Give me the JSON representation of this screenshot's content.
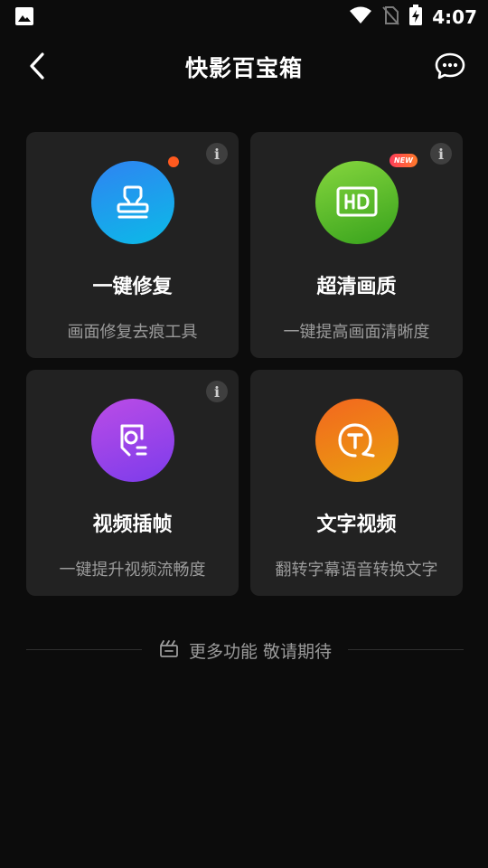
{
  "status_bar": {
    "time": "4:07",
    "icons": [
      "image-icon",
      "wifi-icon",
      "no-sim-icon",
      "battery-charging-icon"
    ]
  },
  "app_bar": {
    "title": "快影百宝箱",
    "back_icon": "back-arrow-icon",
    "chat_icon": "chat-bubble-icon"
  },
  "cards": [
    {
      "title": "一键修复",
      "subtitle": "画面修复去痕工具",
      "icon": "stamp-icon",
      "gradient": [
        "#2a8cf0",
        "#0fb9e6"
      ],
      "has_info": true,
      "has_dot": true
    },
    {
      "title": "超清画质",
      "subtitle": "一键提高画面清晰度",
      "icon": "hd-icon",
      "gradient": [
        "#7fd13a",
        "#3aa51e"
      ],
      "has_info": true,
      "badge": "NEW"
    },
    {
      "title": "视频插帧",
      "subtitle": "一键提升视频流畅度",
      "icon": "frame-interpolation-icon",
      "gradient": [
        "#b54ae8",
        "#7a3bea"
      ],
      "has_info": true
    },
    {
      "title": "文字视频",
      "subtitle": "翻转字幕语音转换文字",
      "icon": "text-t-icon",
      "gradient": [
        "#f36a1d",
        "#ea9a10"
      ],
      "has_info": false
    }
  ],
  "footer": {
    "text": "更多功能 敬请期待",
    "icon": "clapperboard-icon"
  },
  "colors": {
    "background": "#0c0c0c",
    "card": "#222222",
    "subtitle": "#9b9b9b",
    "dot": "#ff5a1f"
  }
}
